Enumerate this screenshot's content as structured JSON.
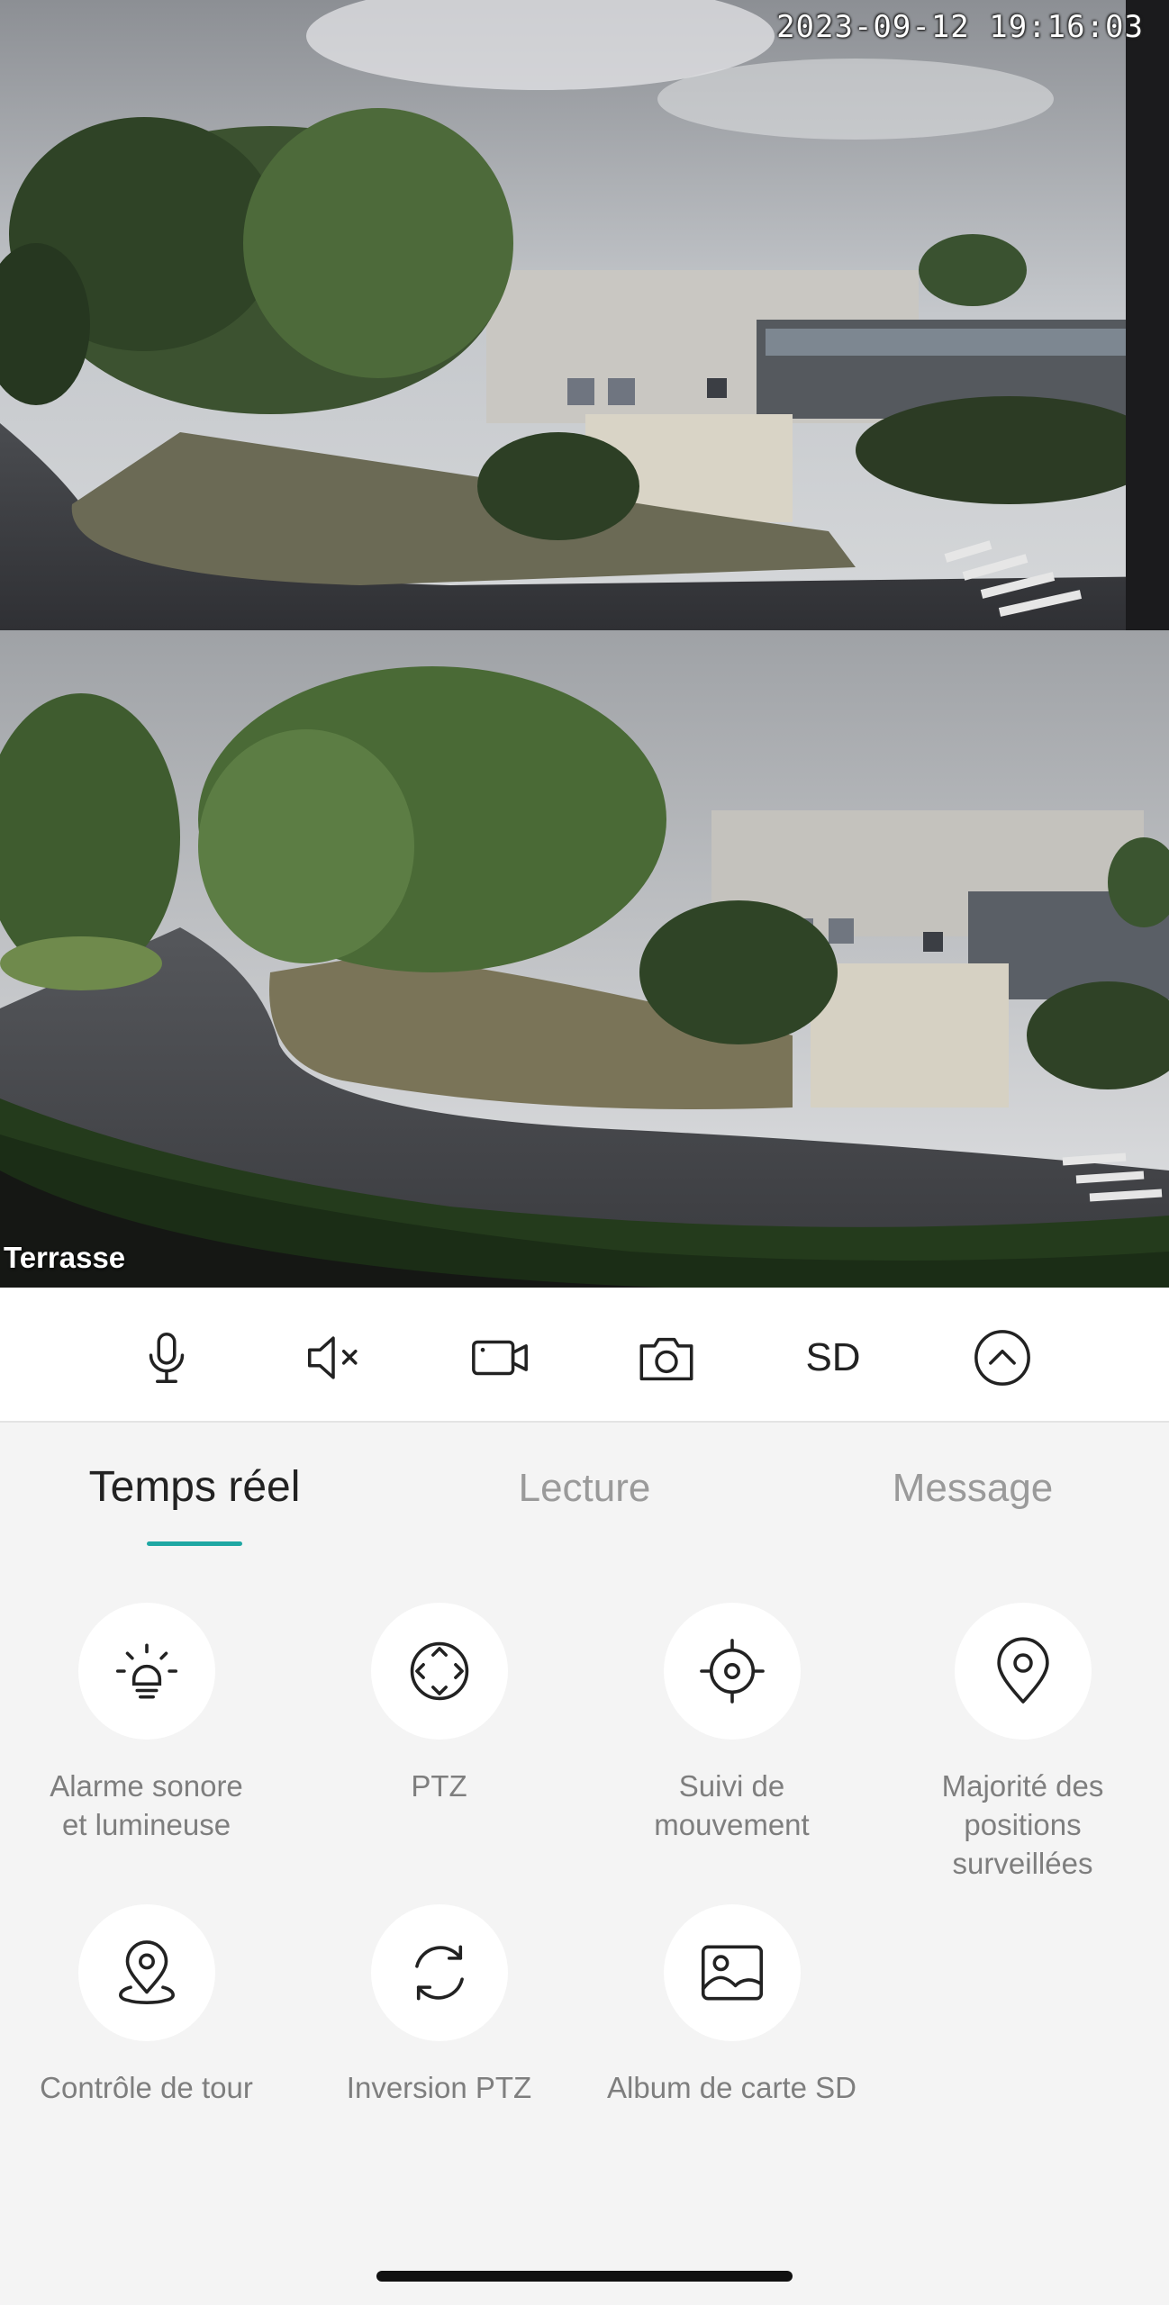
{
  "camera_top": {
    "timestamp": "2023-09-12 19:16:03"
  },
  "camera_bottom": {
    "label": "Terrasse"
  },
  "controls": [
    {
      "name": "microphone-button",
      "icon": "microphone-icon"
    },
    {
      "name": "mute-button",
      "icon": "speaker-muted-icon"
    },
    {
      "name": "record-button",
      "icon": "video-camera-icon"
    },
    {
      "name": "snapshot-button",
      "icon": "camera-icon"
    },
    {
      "name": "quality-button",
      "label": "SD"
    },
    {
      "name": "collapse-button",
      "icon": "chevron-up-circle-icon"
    }
  ],
  "tabs": [
    {
      "label": "Temps réel",
      "active": true
    },
    {
      "label": "Lecture",
      "active": false
    },
    {
      "label": "Message",
      "active": false
    }
  ],
  "features": [
    {
      "label": "Alarme sonore\net lumineuse",
      "icon": "alarm-light-icon"
    },
    {
      "label": "PTZ",
      "icon": "ptz-directions-icon"
    },
    {
      "label": "Suivi de\nmouvement",
      "icon": "motion-tracking-crosshair-icon"
    },
    {
      "label": "Majorité des\npositions\nsurveillées",
      "icon": "location-pin-icon"
    },
    {
      "label": "Contrôle de tour",
      "icon": "tour-location-icon"
    },
    {
      "label": "Inversion PTZ",
      "icon": "rotate-arrows-icon"
    },
    {
      "label": "Album de carte SD",
      "icon": "picture-album-icon"
    }
  ],
  "colors": {
    "accent": "#1fa7a3",
    "background": "#f4f4f4",
    "text_inactive": "#9a9a9a"
  }
}
